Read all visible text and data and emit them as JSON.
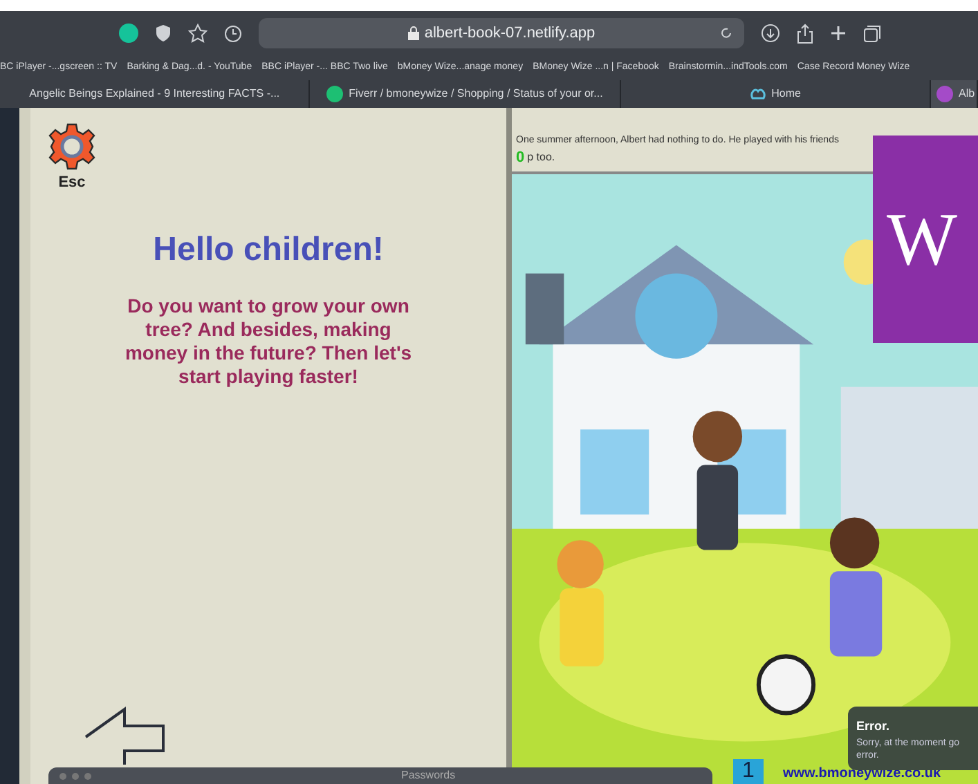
{
  "toolbar": {
    "url": "albert-book-07.netlify.app"
  },
  "bookmarks": [
    "BC iPlayer -...gscreen :: TV",
    "Barking & Dag...d. - YouTube",
    "BBC iPlayer -... BBC Two live",
    "bMoney Wize...anage money",
    "BMoney Wize ...n | Facebook",
    "Brainstormin...indTools.com",
    "Case Record Money Wize"
  ],
  "tabs": [
    {
      "label": "Angelic Beings Explained - 9 Interesting FACTS -...",
      "selected": false,
      "kind": "plain"
    },
    {
      "label": "Fiverr / bmoneywize / Shopping / Status of your or...",
      "selected": false,
      "kind": "fiverr"
    },
    {
      "label": "Home",
      "selected": false,
      "kind": "home"
    },
    {
      "label": "Alb",
      "selected": true,
      "kind": "app"
    }
  ],
  "left_page": {
    "settings_label": "Esc",
    "title": "Hello children!",
    "message": "Do you want to grow your own tree? And besides, making money in the future? Then let's start playing faster!"
  },
  "right_page": {
    "story_line_1": "One summer afternoon, Albert had nothing to do. He played with his friends",
    "story_line_2": "p too.",
    "marker": "0",
    "banner_letter": "W",
    "page_number": "1",
    "link": "www.bmoneywize.co.uk"
  },
  "toast": {
    "title": "Error.",
    "line_1": "Sorry, at the moment go",
    "line_2": "error."
  },
  "passwords_window": {
    "title": "Passwords"
  }
}
